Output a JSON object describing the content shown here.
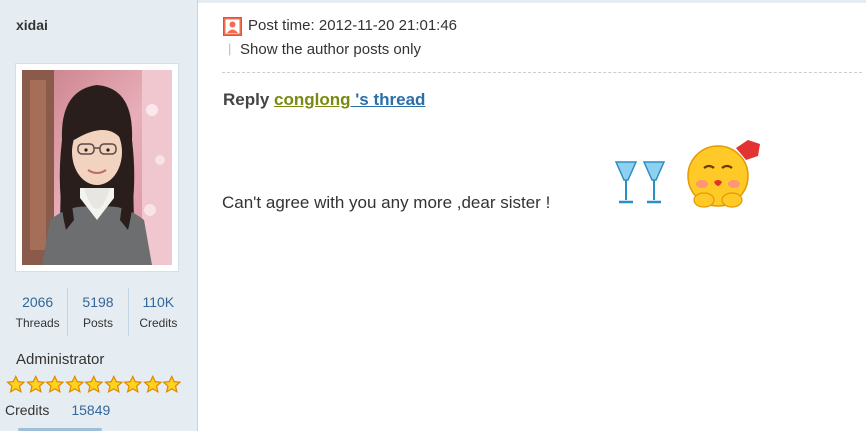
{
  "author": {
    "username": "xidai",
    "stats": [
      {
        "value": "2066",
        "label": "Threads"
      },
      {
        "value": "5198",
        "label": "Posts"
      },
      {
        "value": "110K",
        "label": "Credits"
      }
    ],
    "role": "Administrator",
    "star_count": 9,
    "credits_label": "Credits",
    "credits_value": "15849"
  },
  "post": {
    "time_text": "Post time: 2012-11-20 21:01:46",
    "separator": "|",
    "author_only_link": "Show the author posts only",
    "reply_label": "Reply",
    "reply_user": "conglong",
    "reply_thread_suffix": " 's thread",
    "message": "Can't agree with you any more ,dear sister !"
  },
  "icons": {
    "post_time": "user-icon",
    "emoticon_1": "cheers-glasses-icon",
    "emoticon_2": "kiss-smiley-icon"
  },
  "colors": {
    "sidebar_bg": "#e5edf2",
    "link_blue": "#336699",
    "user_link": "#7a8a10",
    "thread_link": "#2b6ea8",
    "post_icon": "#f26c4f"
  }
}
